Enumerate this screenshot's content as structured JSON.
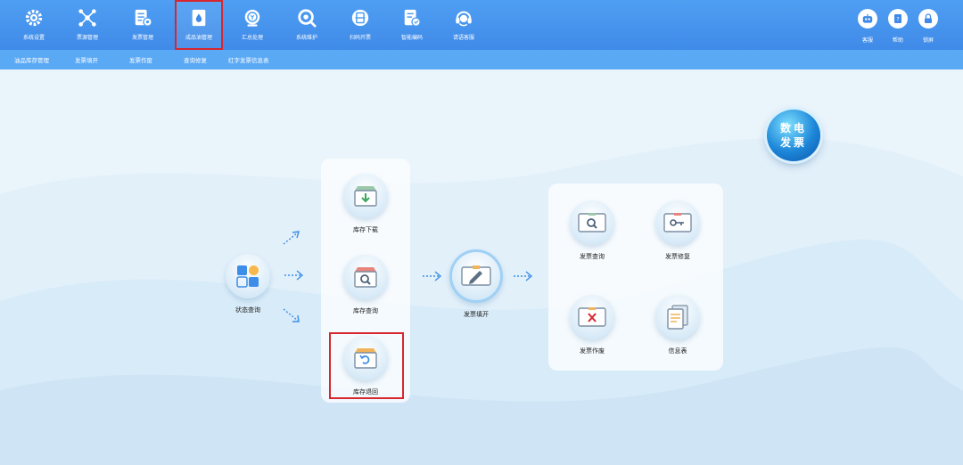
{
  "toolbar": {
    "items": [
      {
        "label": "系统设置",
        "icon": "gear-icon"
      },
      {
        "label": "票源管理",
        "icon": "network-icon"
      },
      {
        "label": "发票管理",
        "icon": "invoice-settings-icon"
      },
      {
        "label": "成品油管理",
        "icon": "oil-drop-icon"
      },
      {
        "label": "汇总处理",
        "icon": "summary-icon"
      },
      {
        "label": "系统维护",
        "icon": "maintenance-icon"
      },
      {
        "label": "扫码开票",
        "icon": "scan-icon"
      },
      {
        "label": "智能编码",
        "icon": "smart-code-icon"
      },
      {
        "label": "请语客服",
        "icon": "headset-icon"
      }
    ],
    "right": [
      {
        "label": "客服",
        "icon": "robot-icon"
      },
      {
        "label": "帮助",
        "icon": "help-book-icon"
      },
      {
        "label": "锁屏",
        "icon": "lock-icon"
      }
    ]
  },
  "subnav": [
    "油品库存管理",
    "发票填开",
    "发票作废",
    "查询修复",
    "红字发票信息表"
  ],
  "flow": {
    "state_query": "状态查询",
    "stock_download": "库存下载",
    "stock_query": "库存查询",
    "stock_return": "库存退回",
    "invoice_fill": "发票填开",
    "invoice_query": "发票查询",
    "invoice_repair": "发票修复",
    "invoice_void": "发票作废",
    "info_sheet": "信息表"
  },
  "badge": {
    "line1": "数电",
    "line2": "发票"
  },
  "colors": {
    "toolbar": "#4f9ff3",
    "subnav": "#5aa9f5",
    "highlight": "#d7262e",
    "accent": "#3d8ee8"
  }
}
